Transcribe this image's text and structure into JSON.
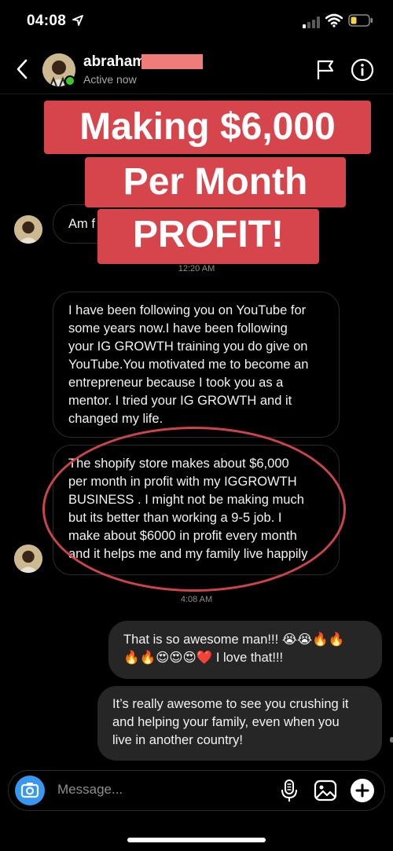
{
  "status_bar": {
    "time": "04:08"
  },
  "header": {
    "name": "abraham",
    "status": "Active now"
  },
  "overlay": {
    "line1": "Making $6,000",
    "line2": "Per Month",
    "line3": "PROFIT!"
  },
  "messages": [
    {
      "direction": "incoming",
      "text": "Am f"
    },
    {
      "timestamp": "12:20 AM"
    },
    {
      "direction": "incoming",
      "lines": [
        "I have been following you on YouTube for",
        "some years now.I have been following",
        "your IG GROWTH training you do give on",
        "YouTube.You motivated me to become an",
        "entrepreneur because I took you as a",
        "mentor.  I tried your IG GROWTH and it",
        "changed  my life."
      ]
    },
    {
      "direction": "incoming",
      "lines": [
        "The shopify store makes about $6,000",
        "per month in profit with my IGGROWTH",
        "BUSINESS . I might not be making much",
        "but its better than working a 9-5 job. I",
        "make about  $6000 in profit every month",
        "and it helps me and my family live happily"
      ]
    },
    {
      "timestamp": "4:08 AM"
    },
    {
      "direction": "outgoing",
      "line1": "That is so awesome man!!! 😭😭🔥🔥",
      "line2": "🔥🔥😍😍😍❤️ I love that!!!"
    },
    {
      "direction": "outgoing",
      "lines": [
        "It’s really awesome to see you crushing it",
        "and helping your family, even when you",
        "live in another country!"
      ]
    }
  ],
  "composer": {
    "placeholder": "Message..."
  },
  "colors": {
    "overlay_red": "#d6454c",
    "circle_red": "#c9454b",
    "online_green": "#3ec72c",
    "camera_blue": "#3897f0"
  },
  "icons": [
    "location-arrow-icon",
    "signal-icon",
    "wifi-icon",
    "battery-icon",
    "back-icon",
    "flag-icon",
    "info-icon",
    "camera-icon",
    "mic-icon",
    "gallery-icon",
    "plus-icon"
  ]
}
